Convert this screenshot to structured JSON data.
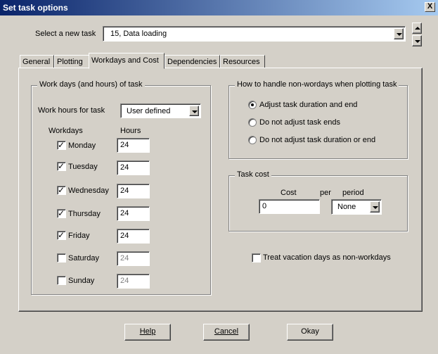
{
  "window": {
    "title": "Set task options",
    "close_label": "X"
  },
  "task_select": {
    "label": "Select a new task",
    "value": "15, Data loading"
  },
  "tabs": [
    {
      "label": "General"
    },
    {
      "label": "Plotting"
    },
    {
      "label": "Workdays and Cost"
    },
    {
      "label": "Dependencies"
    },
    {
      "label": "Resources"
    }
  ],
  "workdays": {
    "group_title": "Work days (and hours) of task",
    "work_hours_label": "Work hours for task",
    "work_hours_value": "User defined",
    "col_workdays": "Workdays",
    "col_hours": "Hours",
    "days": [
      {
        "name": "Monday",
        "checked": true,
        "hours": "24"
      },
      {
        "name": "Tuesday",
        "checked": true,
        "hours": "24"
      },
      {
        "name": "Wednesday",
        "checked": true,
        "hours": "24"
      },
      {
        "name": "Thursday",
        "checked": true,
        "hours": "24"
      },
      {
        "name": "Friday",
        "checked": true,
        "hours": "24"
      },
      {
        "name": "Saturday",
        "checked": false,
        "hours": "24"
      },
      {
        "name": "Sunday",
        "checked": false,
        "hours": "24"
      }
    ]
  },
  "nonworkdays": {
    "group_title": "How to handle non-wordays when plotting task",
    "options": [
      {
        "label": "Adjust task duration and end",
        "selected": true
      },
      {
        "label": "Do not adjust task ends",
        "selected": false
      },
      {
        "label": "Do not adjust task duration or end",
        "selected": false
      }
    ]
  },
  "cost": {
    "group_title": "Task cost",
    "cost_label": "Cost",
    "per_label": "per",
    "period_label": "period",
    "cost_value": "0",
    "period_value": "None"
  },
  "vacation": {
    "label": "Treat vacation days as non-workdays",
    "checked": false
  },
  "buttons": {
    "help": "Help",
    "cancel": "Cancel",
    "okay": "Okay"
  }
}
